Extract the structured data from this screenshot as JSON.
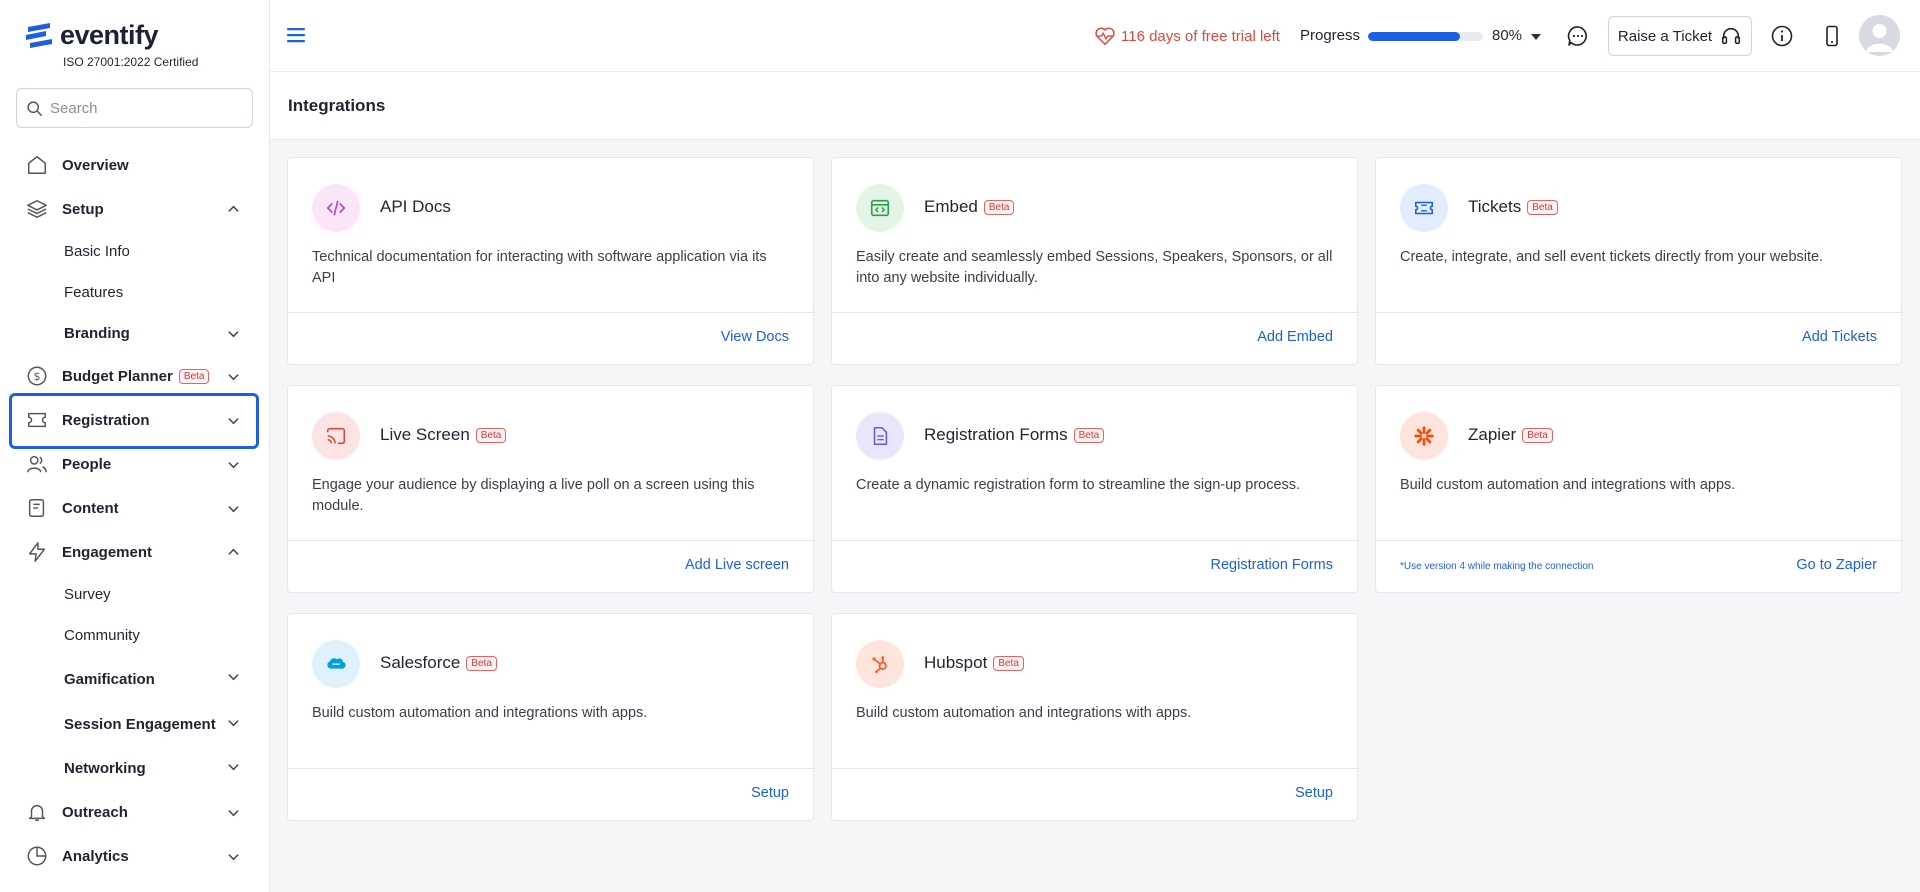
{
  "brand": {
    "name": "eventify",
    "cert": "ISO 27001:2022 Certified"
  },
  "search": {
    "placeholder": "Search"
  },
  "sidebar": {
    "overview": "Overview",
    "setup": "Setup",
    "setup_children": {
      "basic_info": "Basic Info",
      "features": "Features",
      "branding": "Branding"
    },
    "budget_planner": "Budget Planner",
    "budget_badge": "Beta",
    "registration": "Registration",
    "people": "People",
    "content": "Content",
    "engagement": "Engagement",
    "engagement_children": {
      "survey": "Survey",
      "community": "Community",
      "gamification": "Gamification",
      "session_engagement": "Session Engagement",
      "networking": "Networking"
    },
    "outreach": "Outreach",
    "analytics": "Analytics"
  },
  "header": {
    "trial": "116 days of free trial left",
    "progress_label": "Progress",
    "progress_value": 80,
    "progress_text": "80%",
    "ticket_button": "Raise a Ticket"
  },
  "page": {
    "title": "Integrations"
  },
  "cards": {
    "api_docs": {
      "title": "API Docs",
      "desc": "Technical documentation for interacting with software application via its API",
      "action": "View Docs"
    },
    "embed": {
      "title": "Embed",
      "badge": "Beta",
      "desc": "Easily create and seamlessly embed Sessions, Speakers, Sponsors, or all into any website individually.",
      "action": "Add Embed"
    },
    "tickets": {
      "title": "Tickets",
      "badge": "Beta",
      "desc": "Create, integrate, and sell event tickets directly from your website.",
      "action": "Add Tickets"
    },
    "live_screen": {
      "title": "Live Screen",
      "badge": "Beta",
      "desc": "Engage your audience by displaying a live poll on a screen using this module.",
      "action": "Add Live screen"
    },
    "registration_forms": {
      "title": "Registration Forms",
      "badge": "Beta",
      "desc": "Create a dynamic registration form to streamline the sign-up process.",
      "action": "Registration Forms"
    },
    "zapier": {
      "title": "Zapier",
      "badge": "Beta",
      "desc": "Build custom automation and integrations with apps.",
      "note": "*Use version 4 while making the connection",
      "action": "Go to Zapier"
    },
    "salesforce": {
      "title": "Salesforce",
      "badge": "Beta",
      "desc": "Build custom automation and integrations with apps.",
      "action": "Setup"
    },
    "hubspot": {
      "title": "Hubspot",
      "badge": "Beta",
      "desc": "Build custom automation and integrations with apps.",
      "action": "Setup"
    }
  },
  "colors": {
    "accent": "#1d5fe0",
    "beta": "#d63a3a",
    "trial": "#e0463f"
  }
}
